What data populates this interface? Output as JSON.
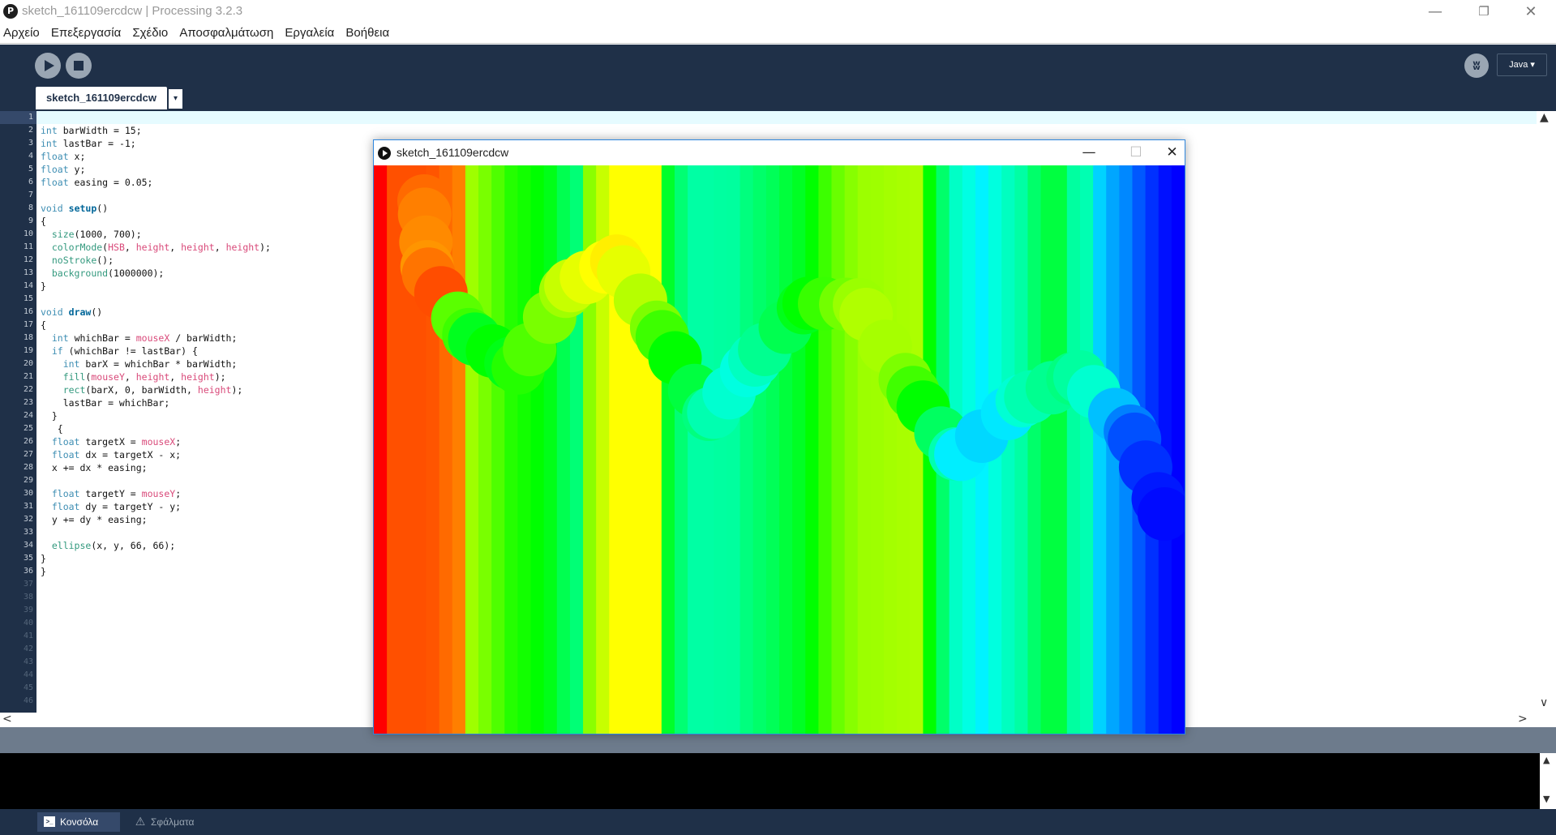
{
  "window": {
    "title": "sketch_161109ercdcw | Processing 3.2.3",
    "app_icon_glyph": "P",
    "minimize_glyph": "—",
    "restore_glyph": "❐",
    "close_glyph": "✕"
  },
  "menu": [
    "Αρχείο",
    "Επεξεργασία",
    "Σχέδιο",
    "Αποσφαλμάτωση",
    "Εργαλεία",
    "Βοήθεια"
  ],
  "toolbar": {
    "run_icon": "play-icon",
    "stop_icon": "stop-icon",
    "debug_icon": "butterfly-icon",
    "mode_label": "Java ▾"
  },
  "tab": {
    "label": "sketch_161109ercdcw",
    "menu_glyph": "▾"
  },
  "editor": {
    "line_count": 46,
    "code": [
      "",
      "int barWidth = 15;",
      "int lastBar = -1;",
      "float x;",
      "float y;",
      "float easing = 0.05;",
      "",
      "void setup()",
      "{",
      "  size(1000, 700);",
      "  colorMode(HSB, height, height, height);",
      "  noStroke();",
      "  background(1000000);",
      "}",
      "",
      "void draw()",
      "{",
      "  int whichBar = mouseX / barWidth;",
      "  if (whichBar != lastBar) {",
      "    int barX = whichBar * barWidth;",
      "    fill(mouseY, height, height);",
      "    rect(barX, 0, barWidth, height);",
      "    lastBar = whichBar;",
      "  }",
      "   {",
      "  float targetX = mouseX;",
      "  float dx = targetX - x;",
      "  x += dx * easing;",
      "",
      "  float targetY = mouseY;",
      "  float dy = targetY - y;",
      "  y += dy * easing;",
      "",
      "  ellipse(x, y, 66, 66);",
      "}",
      "}"
    ]
  },
  "scroll": {
    "up_glyph": "▲",
    "down_glyph": "▼",
    "left_glyph": "<",
    "right_glyph": ">",
    "v_down_glyph": "∨"
  },
  "footer": {
    "console_label": "Κονσόλα",
    "errors_label": "Σφάλματα",
    "console_icon_glyph": ">_",
    "errors_icon_glyph": "⚠"
  },
  "sketch": {
    "title": "sketch_161109ercdcw",
    "minimize_glyph": "—",
    "maximize_glyph": "☐",
    "close_glyph": "✕",
    "bar_colors": [
      "#ff0000",
      "#ff5000",
      "#ff5000",
      "#ff5000",
      "#ff5500",
      "#ff6a00",
      "#ff7f00",
      "#9eff00",
      "#79ff00",
      "#4fff00",
      "#24ff00",
      "#12ff00",
      "#00ff00",
      "#00ff18",
      "#00ff50",
      "#00ff76",
      "#8bff00",
      "#c7ff00",
      "#ffff00",
      "#ffff00",
      "#ffff00",
      "#ffff00",
      "#00ff2a",
      "#00ff73",
      "#00ffa4",
      "#00ffa4",
      "#00ffa0",
      "#00ff9e",
      "#00ff7e",
      "#00ff6a",
      "#00ff58",
      "#00ff3c",
      "#00ff24",
      "#00ff00",
      "#3cff00",
      "#69ff00",
      "#87ff00",
      "#9cff00",
      "#9eff00",
      "#a4ff00",
      "#a8ff00",
      "#acff00",
      "#00ff00",
      "#00ff6a",
      "#00ffc6",
      "#00ffe3",
      "#00f3ff",
      "#00ffdf",
      "#00ffc0",
      "#00ffa4",
      "#00ff6a",
      "#00ff40",
      "#00ff40",
      "#00ffa0",
      "#00ffb2",
      "#00d2ff",
      "#00a6ff",
      "#0088ff",
      "#0058ff",
      "#0030ff",
      "#0010ff",
      "#0000ff"
    ],
    "trail_colors": [
      "#ff6a00",
      "#ff7f00",
      "#ff8a00",
      "#ff9500",
      "#ff7400",
      "#ff4d00",
      "#5aff00",
      "#3cff00",
      "#00ff1e",
      "#00ff00",
      "#00ff16",
      "#24ff00",
      "#4fff00",
      "#79ff00",
      "#a0ff00",
      "#c7ff00",
      "#e6ff00",
      "#ffff00",
      "#ffef00",
      "#e6ff00",
      "#b6ff00",
      "#7cff00",
      "#3dff00",
      "#00ff00",
      "#00ff40",
      "#00ff7f",
      "#00ffb0",
      "#00ffd0",
      "#00ffe0",
      "#00ffc0",
      "#00ff90",
      "#00ff50",
      "#00ff1a",
      "#00ff00",
      "#38ff00",
      "#72ff00",
      "#9aff00",
      "#b0ff00",
      "#a6ff00",
      "#7cff00",
      "#40ff00",
      "#00ff00",
      "#00ff60",
      "#00ffb0",
      "#00eeff",
      "#00d8ff",
      "#00e8ff",
      "#00ffd4",
      "#00ffb0",
      "#00ff90",
      "#00ff80",
      "#00ffa0",
      "#00ffd0",
      "#00c0ff",
      "#0080ff",
      "#0050ff",
      "#0030ff",
      "#0018ff",
      "#000aff"
    ]
  }
}
